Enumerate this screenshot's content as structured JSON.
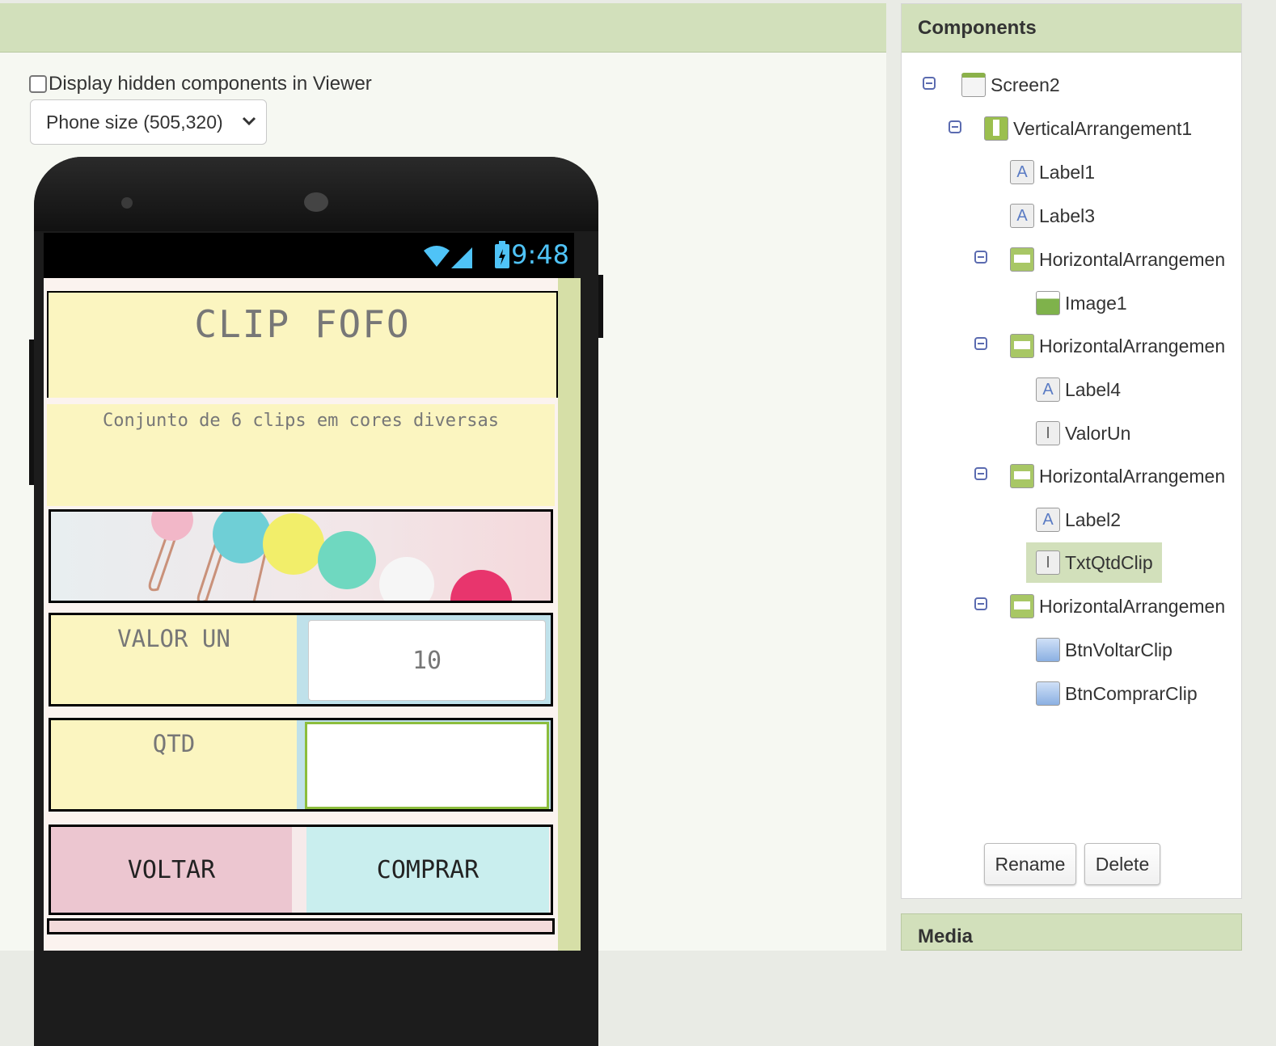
{
  "viewer": {
    "hidden_checkbox_label": "Display hidden components in Viewer",
    "phone_size": "Phone size (505,320)",
    "status_time": "9:48"
  },
  "app": {
    "title": "CLIP FOFO",
    "description": "Conjunto de 6 clips em cores diversas",
    "valor_label": "VALOR UN",
    "valor_value": "10",
    "qtd_label": "QTD",
    "qtd_value": "",
    "btn_voltar": "VOLTAR",
    "btn_comprar": "COMPRAR",
    "btn_voltar_color": "#ecc6d0",
    "btn_comprar_color": "#c9eeee"
  },
  "components": {
    "header": "Components",
    "tree": [
      {
        "label": "Screen2",
        "icon": "screen-icon"
      },
      {
        "label": "VerticalArrangement1",
        "icon": "vertical-arrangement-icon"
      },
      {
        "label": "Label1",
        "icon": "label-icon"
      },
      {
        "label": "Label3",
        "icon": "label-icon"
      },
      {
        "label": "HorizontalArrangemen",
        "icon": "horizontal-arrangement-icon"
      },
      {
        "label": "Image1",
        "icon": "image-icon"
      },
      {
        "label": "HorizontalArrangemen",
        "icon": "horizontal-arrangement-icon"
      },
      {
        "label": "Label4",
        "icon": "label-icon"
      },
      {
        "label": "ValorUn",
        "icon": "textbox-icon"
      },
      {
        "label": "HorizontalArrangemen",
        "icon": "horizontal-arrangement-icon"
      },
      {
        "label": "Label2",
        "icon": "label-icon"
      },
      {
        "label": "TxtQtdClip",
        "icon": "textbox-icon",
        "selected": true
      },
      {
        "label": "HorizontalArrangemen",
        "icon": "horizontal-arrangement-icon"
      },
      {
        "label": "BtnVoltarClip",
        "icon": "button-icon"
      },
      {
        "label": "BtnComprarClip",
        "icon": "button-icon"
      }
    ],
    "rename": "Rename",
    "delete": "Delete"
  },
  "media": {
    "header": "Media"
  }
}
